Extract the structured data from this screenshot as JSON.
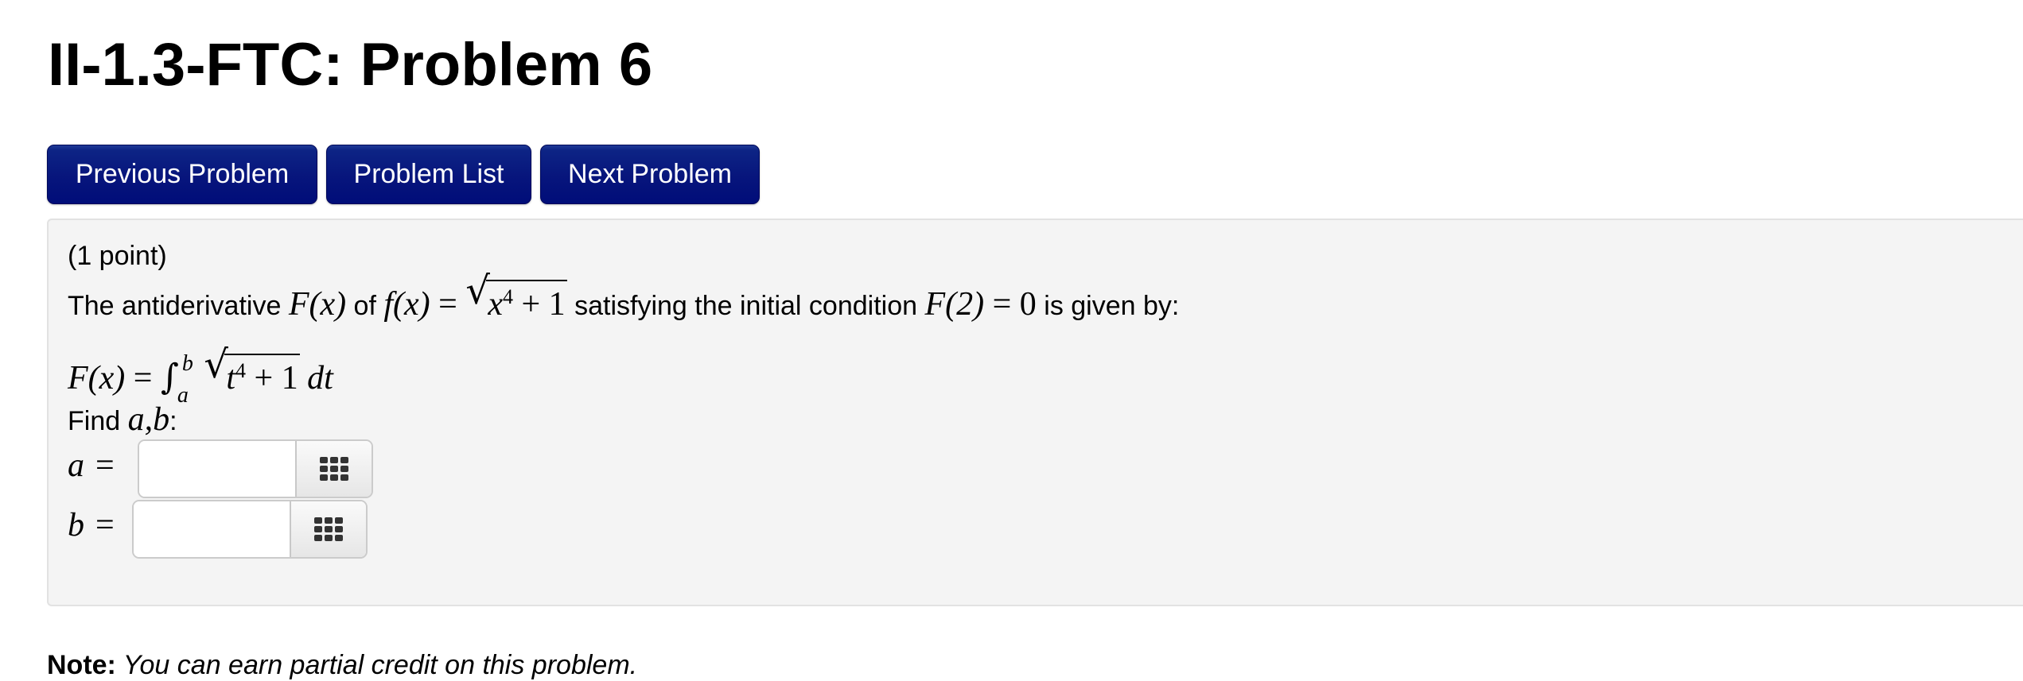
{
  "page": {
    "title": "II-1.3-FTC: Problem 6"
  },
  "nav": {
    "previous_label": "Previous Problem",
    "list_label": "Problem List",
    "next_label": "Next Problem",
    "button_color": "#07157c"
  },
  "problem": {
    "points": "(1 point)",
    "statement": {
      "t1": "The antiderivative ",
      "F_of_x": "F(x)",
      "t2": " of ",
      "f_of_x": "f(x)",
      "equals": " = ",
      "radicand": "x",
      "exp": "4",
      "plus_one": " + 1",
      "t3": " satisfying the initial condition ",
      "cond_lhs": "F(2)",
      "cond_rhs": " = 0",
      "t4": " is given by:"
    },
    "integral": {
      "lhs": "F(x)",
      "equals": " = ",
      "upper": "b",
      "lower": "a",
      "radicand": "t",
      "exp": "4",
      "plus_one": " + 1",
      "dt": "dt"
    },
    "find_prefix": "Find ",
    "find_vars": "a,b",
    "find_suffix": ":",
    "answers": [
      {
        "var": "a",
        "eq": "=",
        "value": "",
        "placeholder": ""
      },
      {
        "var": "b",
        "eq": "=",
        "value": "",
        "placeholder": ""
      }
    ],
    "background": "#f4f4f4"
  },
  "note": {
    "label": "Note:",
    "text": " You can earn partial credit on this problem."
  }
}
